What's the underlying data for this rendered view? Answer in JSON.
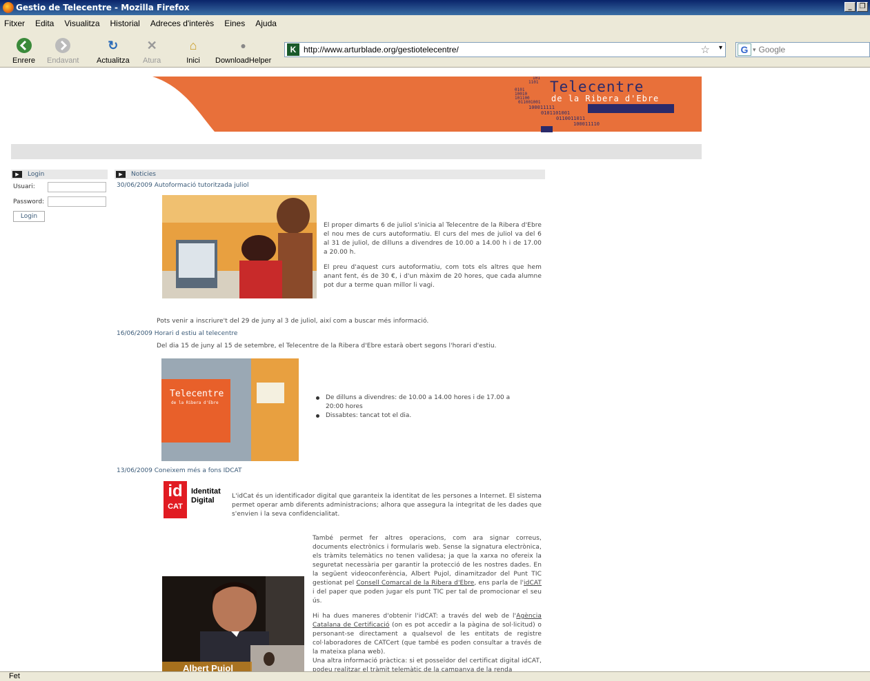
{
  "window": {
    "title": "Gestio de Telecentre - Mozilla Firefox"
  },
  "menu": [
    "Fitxer",
    "Edita",
    "Visualitza",
    "Historial",
    "Adreces d'interès",
    "Eines",
    "Ajuda"
  ],
  "toolbar": {
    "back": "Enrere",
    "forward": "Endavant",
    "reload": "Actualitza",
    "stop": "Atura",
    "home": "Inici",
    "download": "DownloadHelper"
  },
  "address": {
    "url": "http://www.arturblade.org/gestiotelecentre/"
  },
  "search": {
    "placeholder": "Google"
  },
  "status": {
    "text": "Fet"
  },
  "banner": {
    "title": "Telecentre",
    "subtitle": "de la Ribera d'Ebre",
    "binary": [
      "0101",
      "10010",
      "101100",
      "011001001",
      "100011111",
      "0101101001",
      "0110011011",
      "100011110",
      "01010110"
    ],
    "binary_top": [
      "01",
      "101",
      "1101"
    ],
    "colors": {
      "orange": "#e8703a",
      "navy": "#2a2a6a"
    }
  },
  "login": {
    "header": "Login",
    "user_label": "Usuari:",
    "password_label": "Password:",
    "button": "Login"
  },
  "news": {
    "header": "Noticies",
    "items": [
      {
        "date": "30/06/2009",
        "title": "Autoformació tutoritzada juliol",
        "p1": "El proper dimarts 6 de juliol s'inicia al Telecentre de la Ribera d'Ebre el nou mes de curs autoformatiu. El curs del mes de juliol va del  6 al 31 de juliol, de dilluns a divendres de 10.00 a 14.00 h i de 17.00 a 20.00 h.",
        "p2": "El preu d'aquest curs autoformatiu, com tots els altres que hem anant fent,  és de 30 €, i d'un màxim de 20 hores, que cada alumne pot dur a terme quan millor li vagi.",
        "p3": "Pots venir a inscriure't del  29 de juny al 3 de juliol,   així com a buscar més informació."
      },
      {
        "date": "16/06/2009",
        "title": "Horari d estiu al telecentre",
        "intro": "Del dia 15 de juny al 15 de setembre, el Telecentre de la Ribera d'Ebre estarà obert segons l'horari d'estiu.",
        "photo_text": "Telecentre",
        "photo_sub": "de la Ribera d'Ebre",
        "bullets": [
          "De dilluns a divendres: de 10.00 a 14.00 hores i de 17.00 a 20:00 hores",
          "Dissabtes: tancat tot el dia."
        ]
      },
      {
        "date": "13/06/2009",
        "title": "Coneixem més a fons IDCAT",
        "logo_id": "id",
        "logo_cat": "CAT",
        "logo_text1": "Identitat",
        "logo_text2": "Digital",
        "p1": "L'idCat és un identificador digital que garanteix la identitat de les persones a Internet. El sistema permet operar amb diferents administracions; alhora que assegura la integritat de les dades que s'envien i la seva confidencialitat.",
        "p2a": "També permet fer altres operacions, com ara signar correus, documents electrònics i formularis web. Sense la signatura electrònica, els tràmits telemàtics no tenen validesa; ja que la xarxa no ofereix la seguretat necessària per garantir la protecció de les nostres dades. En la següent videoconferència, Albert Pujol, dinamitzador del Punt TIC gestionat pel ",
        "p2link": "Consell Comarcal de la Ribera d'Ebre",
        "p2b": ", ens parla de l'",
        "p2link2": "idCAT ",
        "p2c": " i del paper que poden jugar els punt TIC per tal de promocionar el seu ús.",
        "p3a": " Hi ha dues maneres d'obtenir l'idCAT: a través del web de l'",
        "p3link": "Agència Catalana de Certificació",
        "p3b": " (on es pot accedir a la pàgina de sol·licitud) o personant-se directament a qualsevol de les entitats de registre col·laboradores de CATCert (que també es poden consultar a través de la mateixa plana web).",
        "p4": "Una altra informació pràctica: si et posseïdor del certificat digital idCAT, podeu realitzar el tràmit telemàtic de la campanya de la renda",
        "video_caption": "Albert Pujol"
      }
    ]
  }
}
